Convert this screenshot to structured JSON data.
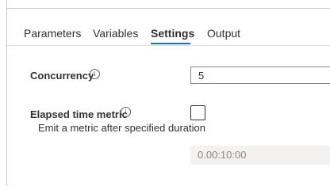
{
  "tabs": [
    {
      "label": "Parameters",
      "active": false
    },
    {
      "label": "Variables",
      "active": false
    },
    {
      "label": "Settings",
      "active": true
    },
    {
      "label": "Output",
      "active": false
    }
  ],
  "settings": {
    "concurrency": {
      "label": "Concurrency",
      "info_icon": "info-icon",
      "value": "5"
    },
    "elapsed_time_metric": {
      "label": "Elapsed time metric",
      "info_icon": "info-icon",
      "checked": false,
      "description": "Emit a metric after specified duration",
      "duration_value": "0.00:10:00"
    }
  },
  "colors": {
    "accent": "#0078d4",
    "text": "#323130",
    "disabled_bg": "#f3f2f1",
    "disabled_text": "#8a8886",
    "border": "#8a8886"
  }
}
